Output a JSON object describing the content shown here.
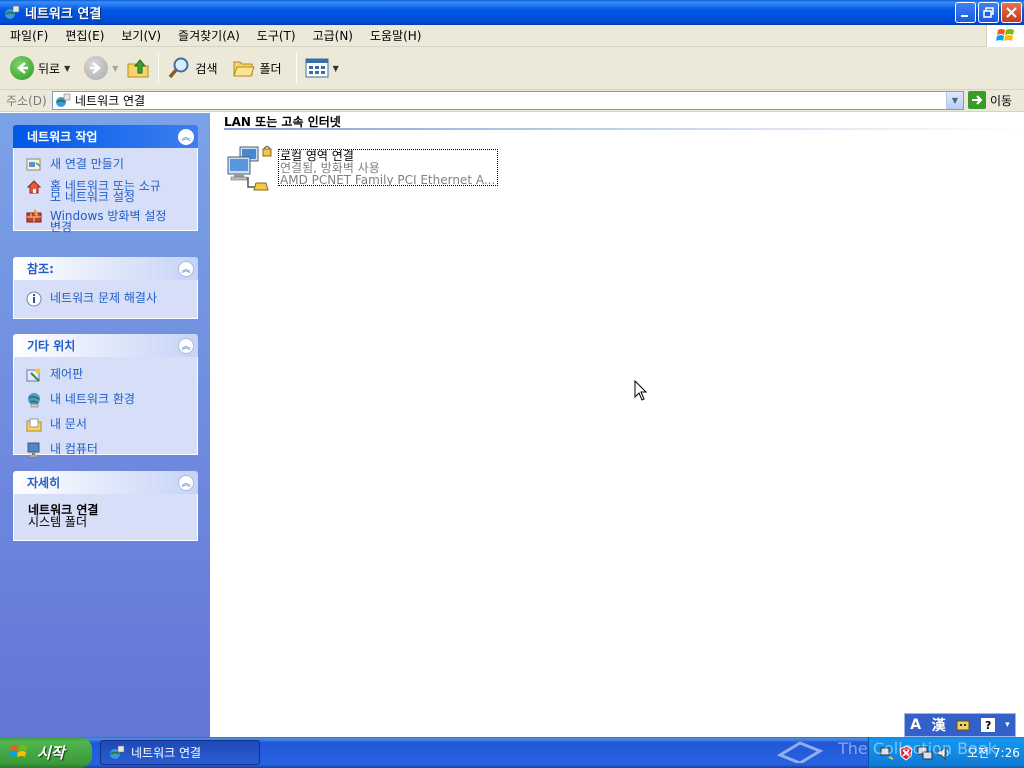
{
  "window": {
    "title": "네트워크 연결",
    "icon": "network-connections-icon"
  },
  "menubar": {
    "items": [
      "파일(F)",
      "편집(E)",
      "보기(V)",
      "즐겨찾기(A)",
      "도구(T)",
      "고급(N)",
      "도움말(H)"
    ]
  },
  "toolbar": {
    "back_label": "뒤로",
    "search_label": "검색",
    "folders_label": "폴더"
  },
  "address": {
    "label": "주소(D)",
    "value": "네트워크 연결",
    "go_label": "이동"
  },
  "taskpane": {
    "network_tasks": {
      "title": "네트워크 작업",
      "items": [
        {
          "line1": "새 연결 만들기",
          "line2": "",
          "icon": "new-connection-icon"
        },
        {
          "line1": "홈 네트워크 또는 소규",
          "line2": "모 네트워크 설정",
          "icon": "home-network-icon"
        },
        {
          "line1": "Windows 방화벽 설정",
          "line2": "변경",
          "icon": "firewall-icon"
        }
      ]
    },
    "see_also": {
      "title": "참조:",
      "items": [
        {
          "line1": "네트워크 문제 해결사",
          "icon": "info-icon"
        }
      ]
    },
    "other_places": {
      "title": "기타 위치",
      "items": [
        {
          "line1": "제어판",
          "icon": "control-panel-icon"
        },
        {
          "line1": "내 네트워크 환경",
          "icon": "my-network-icon"
        },
        {
          "line1": "내 문서",
          "icon": "my-documents-icon"
        },
        {
          "line1": "내 컴퓨터",
          "icon": "my-computer-icon"
        }
      ]
    },
    "details": {
      "title": "자세히",
      "name": "네트워크 연결",
      "type": "시스템 폴더"
    }
  },
  "content": {
    "group_header": "LAN 또는 고속 인터넷",
    "connection": {
      "name": "로컬 영역 연결",
      "status": "연결됨, 방화벽 사용",
      "device": "AMD PCNET Family PCI Ethernet A..."
    }
  },
  "ime": {
    "mode": "A",
    "hanja": "漢"
  },
  "taskbar": {
    "start_label": "시작",
    "window_button": "네트워크 연결",
    "clock": "오전 7:26",
    "watermark": "The Collection Book"
  },
  "colors": {
    "title_blue": "#0058e6",
    "taskpane_top": "#7ba2e7",
    "taskpane_bottom": "#6375d6",
    "link_blue": "#215dc6",
    "start_green": "#3c9a3c"
  }
}
